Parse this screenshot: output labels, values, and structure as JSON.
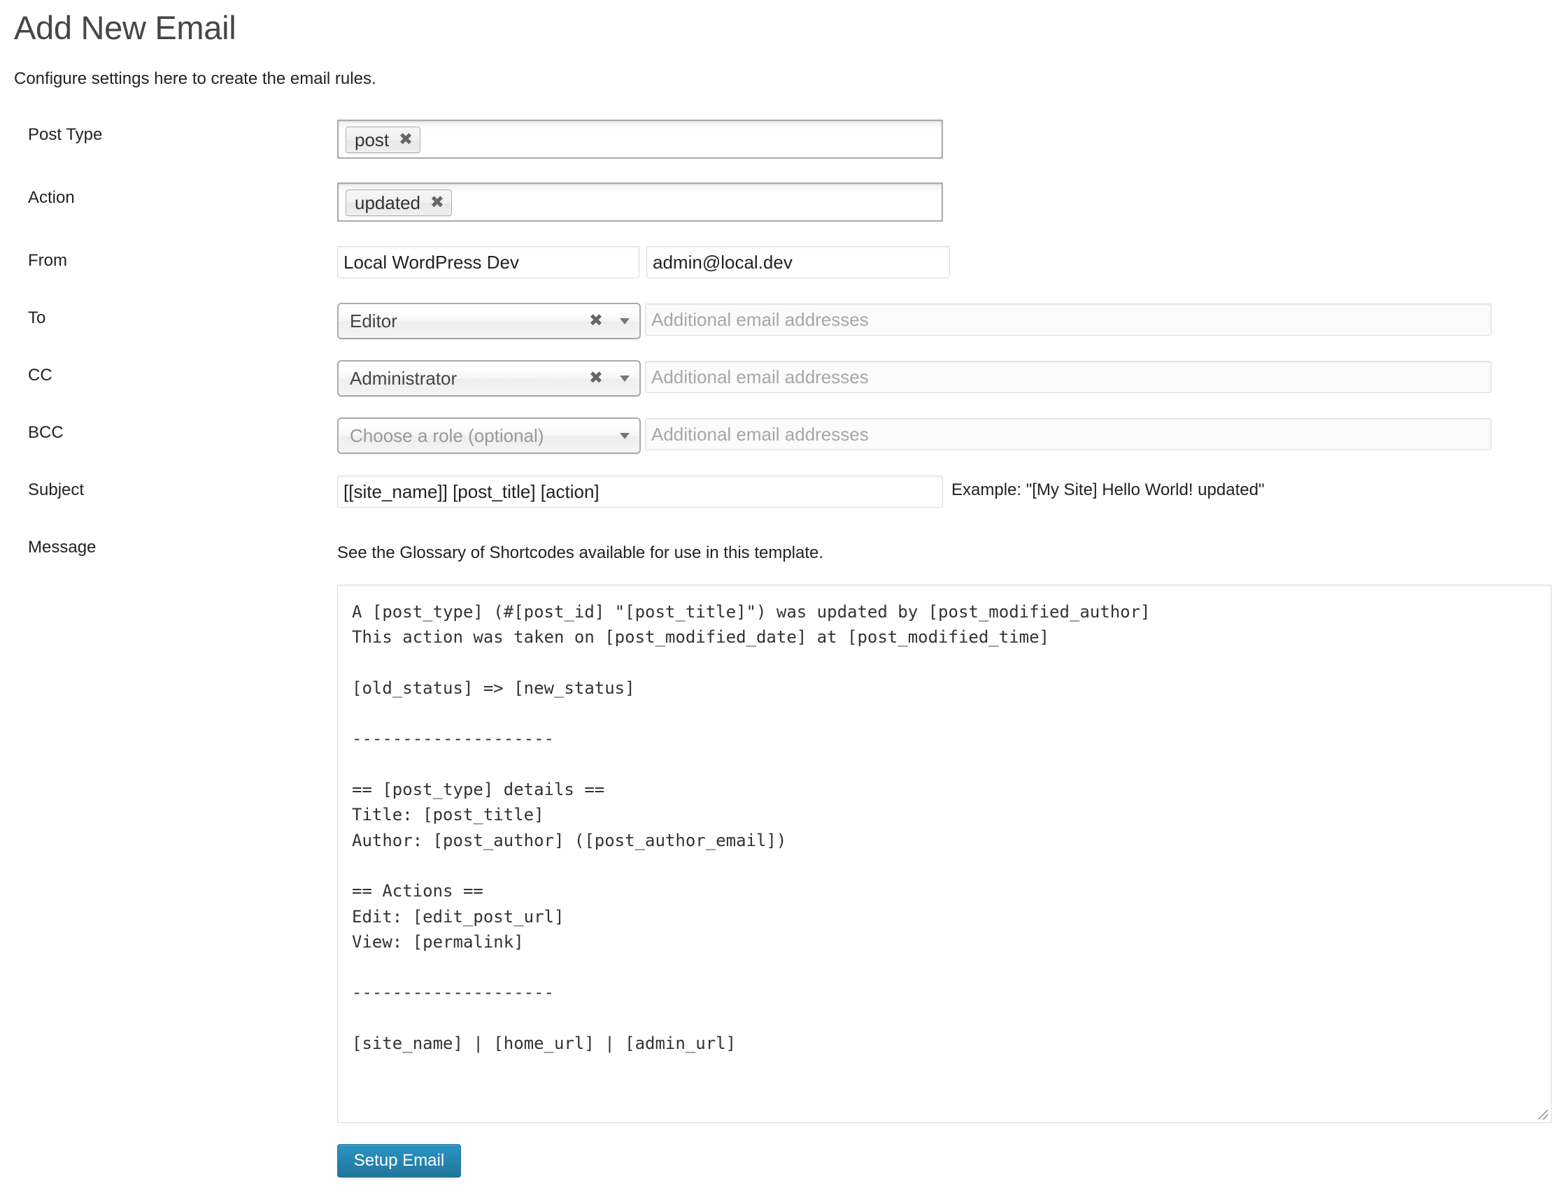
{
  "page": {
    "title": "Add New Email",
    "intro": "Configure settings here to create the email rules."
  },
  "form": {
    "post_type": {
      "label": "Post Type",
      "tags": [
        "post"
      ]
    },
    "action": {
      "label": "Action",
      "tags": [
        "updated"
      ]
    },
    "from": {
      "label": "From",
      "name_value": "Local WordPress Dev",
      "email_value": "admin@local.dev"
    },
    "to": {
      "label": "To",
      "role_selected": "Editor",
      "emails_placeholder": "Additional email addresses"
    },
    "cc": {
      "label": "CC",
      "role_selected": "Administrator",
      "emails_placeholder": "Additional email addresses"
    },
    "bcc": {
      "label": "BCC",
      "role_placeholder": "Choose a role (optional)",
      "emails_placeholder": "Additional email addresses"
    },
    "subject": {
      "label": "Subject",
      "value": "[[site_name]] [post_title] [action]",
      "example": "Example: \"[My Site] Hello World! updated\""
    },
    "message": {
      "label": "Message",
      "glossary_note": "See the Glossary of Shortcodes available for use in this template.",
      "lines": [
        "A [post_type] (#[post_id] \"[post_title]\") was updated by [post_modified_author]",
        "This action was taken on [post_modified_date] at [post_modified_time]",
        "",
        "[old_status] => [new_status]",
        "",
        "--------------------",
        "",
        "== [post_type] details ==",
        "Title: [post_title]",
        "Author: [post_author] ([post_author_email])",
        "",
        "== Actions ==",
        "Edit: [edit_post_url]",
        "View: [permalink]",
        "",
        "--------------------",
        "",
        "[site_name] | [home_url] | [admin_url]"
      ]
    },
    "submit_label": "Setup Email"
  },
  "icons": {
    "remove": "close-icon",
    "dropdown": "chevron-down-icon",
    "resize": "resize-grip-icon"
  },
  "colors": {
    "button_bg": "#21759b",
    "button_text": "#ffffff",
    "title": "#464646",
    "placeholder": "#a7a7a7"
  }
}
